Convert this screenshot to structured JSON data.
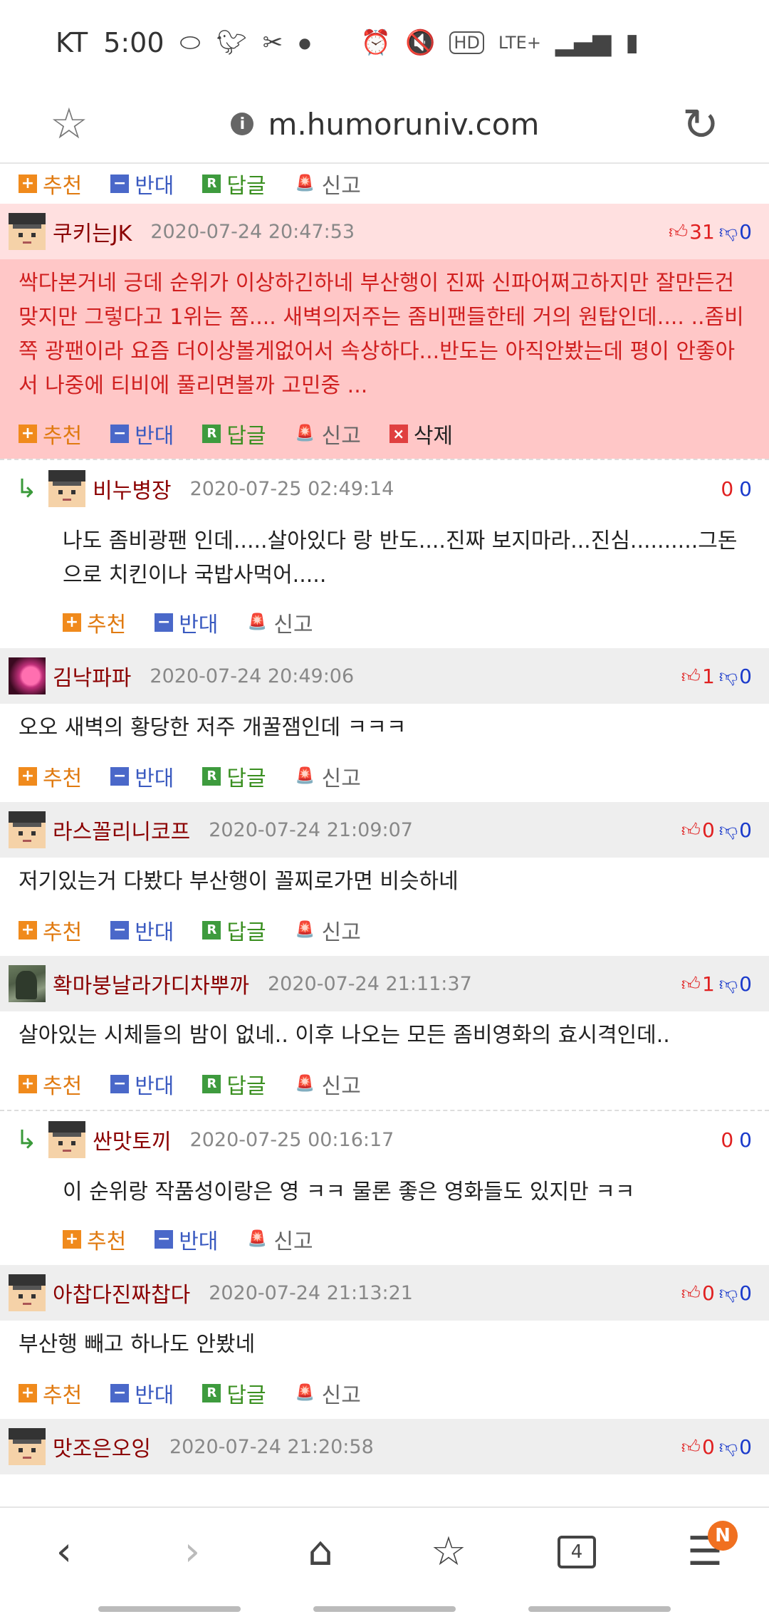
{
  "status": {
    "carrier": "KT",
    "time": "5:00",
    "network": "LTE+",
    "hd": "HD"
  },
  "browser": {
    "url": "m.humoruniv.com"
  },
  "labels": {
    "recommend": "추천",
    "oppose": "반대",
    "reply": "답글",
    "report": "신고",
    "delete": "삭제"
  },
  "comments": [
    {
      "nick": "쿠키는JK",
      "date": "2020-07-24 20:47:53",
      "up": "31",
      "down": "0",
      "text": "싹다본거네 긍데 순위가 이상하긴하네 부산행이 진짜 신파어쩌고하지만 잘만든건 맞지만 그렇다고 1위는 쫌.... 새벽의저주는 좀비팬들한테 거의 원탑인데.... ..좀비쪽 광팬이라 요즘 더이상볼게없어서 속상하다...반도는 아직안봤는데 평이 안좋아서 나중에 티비에 풀리면볼까 고민중 ..."
    },
    {
      "nick": "비누병장",
      "date": "2020-07-25 02:49:14",
      "up": "0",
      "down": "0",
      "text": "나도 좀비광팬 인데.....살아있다 랑 반도....진짜 보지마라...진심..........그돈으로 치킨이나 국밥사먹어....."
    },
    {
      "nick": "김낙파파",
      "date": "2020-07-24 20:49:06",
      "up": "1",
      "down": "0",
      "text": "오오 새벽의 황당한 저주 개꿀잼인데 ㅋㅋㅋ"
    },
    {
      "nick": "라스꼴리니코프",
      "date": "2020-07-24 21:09:07",
      "up": "0",
      "down": "0",
      "text": "저기있는거 다봤다 부산행이 꼴찌로가면 비슷하네"
    },
    {
      "nick": "확마붕날라가디차뿌까",
      "date": "2020-07-24 21:11:37",
      "up": "1",
      "down": "0",
      "text": "살아있는 시체들의 밤이 없네.. 이후 나오는 모든 좀비영화의 효시격인데.."
    },
    {
      "nick": "싼맛토끼",
      "date": "2020-07-25 00:16:17",
      "up": "0",
      "down": "0",
      "text": "이 순위랑 작품성이랑은 영 ㅋㅋ 물론 좋은 영화들도 있지만 ㅋㅋ"
    },
    {
      "nick": "아찹다진짜찹다",
      "date": "2020-07-24 21:13:21",
      "up": "0",
      "down": "0",
      "text": "부산행 빼고 하나도 안봤네"
    },
    {
      "nick": "맛조은오잉",
      "date": "2020-07-24 21:20:58",
      "up": "0",
      "down": "0"
    }
  ],
  "nav": {
    "tab_count": "4",
    "badge": "N"
  }
}
